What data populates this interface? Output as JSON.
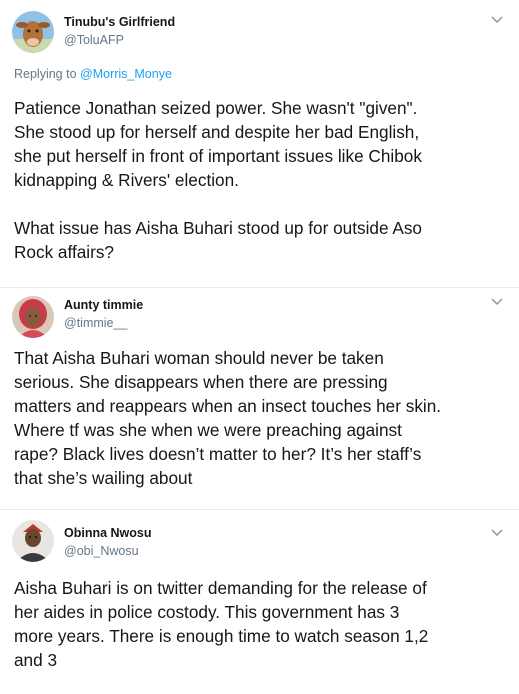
{
  "tweets": [
    {
      "display_name": "Tinubu's Girlfriend",
      "handle": "@ToluAFP",
      "avatar_icon": "cow-avatar-icon",
      "replying_prefix": "Replying to ",
      "replying_to": "@Morris_Monye",
      "text": "Patience Jonathan seized power. She wasn't \"given\".\nShe stood up for herself and despite her bad English,\nshe put herself in front of important issues like  Chibok\nkidnapping & Rivers' election.\n\nWhat issue has Aisha Buhari stood up for outside Aso\nRock affairs?"
    },
    {
      "display_name": "Aunty timmie",
      "handle": "@timmie__",
      "avatar_icon": "woman-avatar-icon",
      "text": "That Aisha Buhari woman should never be taken\nserious. She disappears when there are pressing\nmatters and reappears when an insect touches her skin.\nWhere tf was she when we were preaching against\nrape? Black lives doesn’t matter to her? It’s her staff’s\nthat she’s wailing about"
    },
    {
      "display_name": "Obinna Nwosu",
      "handle": "@obi_Nwosu",
      "avatar_icon": "man-avatar-icon",
      "text": "Aisha Buhari is on twitter demanding for the release of\nher aides in police costody. This government has 3\nmore years. There is enough time to watch season 1,2\nand 3"
    }
  ],
  "colors": {
    "name": "#14171a",
    "secondary": "#657786",
    "link": "#1da1f2",
    "divider": "#e6ecf0"
  }
}
